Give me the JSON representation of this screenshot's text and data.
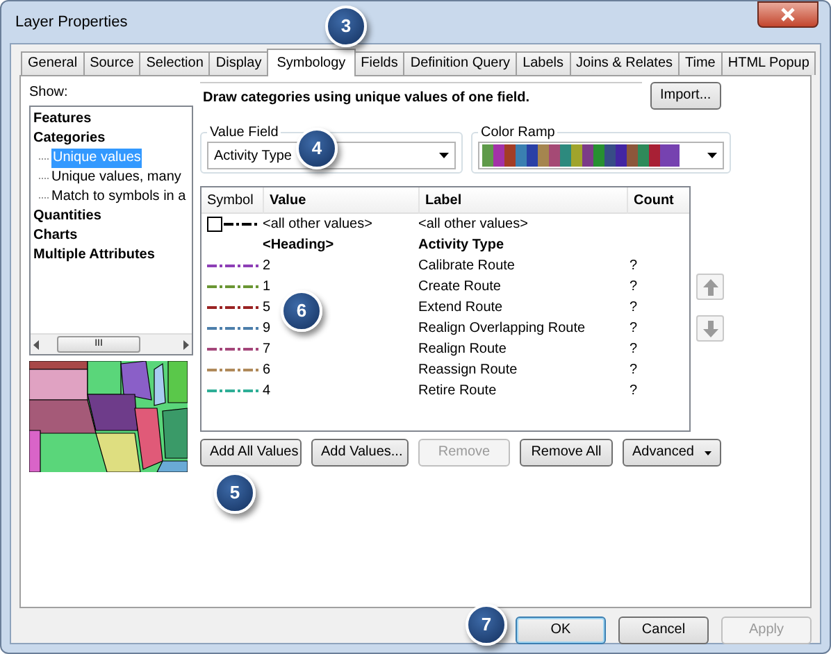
{
  "window": {
    "title": "Layer Properties"
  },
  "tabs": [
    {
      "label": "General",
      "selected": false
    },
    {
      "label": "Source",
      "selected": false
    },
    {
      "label": "Selection",
      "selected": false
    },
    {
      "label": "Display",
      "selected": false
    },
    {
      "label": "Symbology",
      "selected": true
    },
    {
      "label": "Fields",
      "selected": false
    },
    {
      "label": "Definition Query",
      "selected": false
    },
    {
      "label": "Labels",
      "selected": false
    },
    {
      "label": "Joins & Relates",
      "selected": false
    },
    {
      "label": "Time",
      "selected": false
    },
    {
      "label": "HTML Popup",
      "selected": false
    }
  ],
  "show": {
    "label": "Show:",
    "tree": [
      {
        "label": "Features",
        "selected": false
      },
      {
        "label": "Categories",
        "selected": false,
        "children": [
          {
            "label": "Unique values",
            "selected": true
          },
          {
            "label": "Unique values, many",
            "selected": false
          },
          {
            "label": "Match to symbols in a",
            "selected": false
          }
        ]
      },
      {
        "label": "Quantities",
        "selected": false
      },
      {
        "label": "Charts",
        "selected": false
      },
      {
        "label": "Multiple Attributes",
        "selected": false
      }
    ],
    "scroll_grip": "III"
  },
  "description": "Draw categories using unique values of one field.",
  "import_button": "Import...",
  "value_field": {
    "legend": "Value Field",
    "value": "Activity Type"
  },
  "color_ramp": {
    "legend": "Color Ramp",
    "colors": [
      {
        "color": "#5f9a4a"
      },
      {
        "color": "#a332a8"
      },
      {
        "color": "#a33d26"
      },
      {
        "color": "#3a7fb1"
      },
      {
        "color": "#2a40a6"
      },
      {
        "color": "#a5854f"
      },
      {
        "color": "#a54a75"
      },
      {
        "color": "#2d8a7e"
      },
      {
        "color": "#a0a42c"
      },
      {
        "color": "#7c3b88"
      },
      {
        "color": "#279031"
      },
      {
        "color": "#374c86"
      },
      {
        "color": "#4325a2"
      },
      {
        "color": "#8c573b"
      },
      {
        "color": "#2e8a5a"
      },
      {
        "color": "#a82035"
      },
      {
        "color": "#7642b0"
      }
    ]
  },
  "table": {
    "columns": [
      "Symbol",
      "Value",
      "Label",
      "Count"
    ],
    "rows": [
      {
        "kind": "other",
        "value": "<all other values>",
        "label": "<all other values>"
      },
      {
        "kind": "heading",
        "value": "<Heading>",
        "label": "Activity Type"
      },
      {
        "kind": "value",
        "color": "#8e3fb6",
        "value": "2",
        "label": "Calibrate Route",
        "count": "?"
      },
      {
        "kind": "value",
        "color": "#6a9634",
        "value": "1",
        "label": "Create Route",
        "count": "?"
      },
      {
        "kind": "value",
        "color": "#9a2323",
        "value": "5",
        "label": "Extend Route",
        "count": "?"
      },
      {
        "kind": "value",
        "color": "#4d7fab",
        "value": "9",
        "label": "Realign Overlapping Route",
        "count": "?"
      },
      {
        "kind": "value",
        "color": "#a4467a",
        "value": "7",
        "label": "Realign Route",
        "count": "?"
      },
      {
        "kind": "value",
        "color": "#b08a5a",
        "value": "6",
        "label": "Reassign Route",
        "count": "?"
      },
      {
        "kind": "value",
        "color": "#2fae96",
        "value": "4",
        "label": "Retire Route",
        "count": "?"
      }
    ]
  },
  "actions": [
    {
      "label": "Add All Values",
      "disabled": false
    },
    {
      "label": "Add Values...",
      "disabled": false
    },
    {
      "label": "Remove",
      "disabled": true
    },
    {
      "label": "Remove All",
      "disabled": false
    },
    {
      "label": "Advanced",
      "disabled": false,
      "kind": "menu"
    }
  ],
  "dialog_buttons": [
    {
      "label": "OK",
      "disabled": false,
      "default": true
    },
    {
      "label": "Cancel",
      "disabled": false,
      "default": false
    },
    {
      "label": "Apply",
      "disabled": true,
      "default": false
    }
  ],
  "callouts": [
    "3",
    "4",
    "5",
    "6",
    "7"
  ]
}
